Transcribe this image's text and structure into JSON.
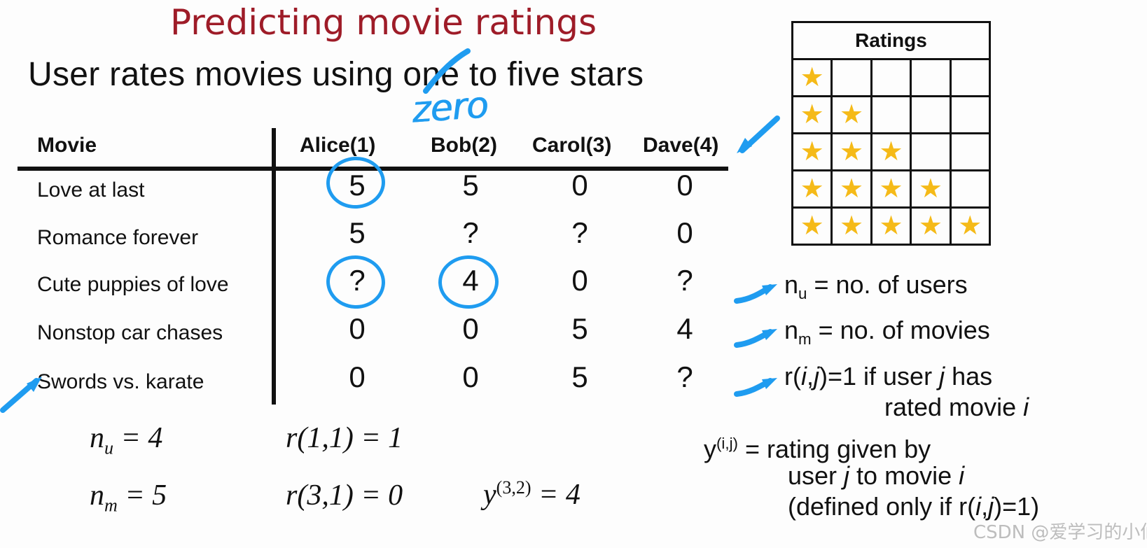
{
  "slide": {
    "title": "Predicting movie ratings",
    "title_color": "#9e1c28",
    "subtitle": "User rates movies using one to five stars",
    "background": "#fdfdfd"
  },
  "ink": {
    "color": "#1f9cf0",
    "zero_annotation": "zero",
    "strikethrough_word": "one",
    "circled_cells": [
      "Love at last / Alice(1) = 5",
      "Cute puppies of love / Alice(1) = ?",
      "Cute puppies of love / Bob(2) = 4"
    ],
    "arrows": [
      "arrow-to-ratings-table",
      "arrow-to-swords-row",
      "arrow-to-nu-note",
      "arrow-to-nm-note",
      "arrow-to-r-note"
    ]
  },
  "matrix": {
    "headers": [
      "Movie",
      "Alice(1)",
      "Bob(2)",
      "Carol(3)",
      "Dave(4)"
    ],
    "rows": [
      {
        "movie": "Love at last",
        "ratings": [
          "5",
          "5",
          "0",
          "0"
        ]
      },
      {
        "movie": "Romance forever",
        "ratings": [
          "5",
          "?",
          "?",
          "0"
        ]
      },
      {
        "movie": "Cute puppies of love",
        "ratings": [
          "?",
          "4",
          "0",
          "?"
        ]
      },
      {
        "movie": "Nonstop car chases",
        "ratings": [
          "0",
          "0",
          "5",
          "4"
        ]
      },
      {
        "movie": "Swords vs. karate",
        "ratings": [
          "0",
          "0",
          "5",
          "?"
        ]
      }
    ]
  },
  "formulas": {
    "n_u": {
      "symbol": "n",
      "sub": "u",
      "rel": " = 4"
    },
    "n_m": {
      "symbol": "n",
      "sub": "m",
      "rel": " = 5"
    },
    "r_1_1": "r(1,1) = 1",
    "r_3_1": "r(3,1) = 0",
    "y_3_2": {
      "base": "y",
      "sup": "(3,2)",
      "rel": " = 4"
    }
  },
  "ratings_table": {
    "header": "Ratings",
    "columns": 5,
    "rows": 5,
    "filled_stars_per_row": [
      1,
      2,
      3,
      4,
      5
    ],
    "star_glyph": "★",
    "star_color": "#F5BA18"
  },
  "notes": {
    "nu": {
      "sym": "n",
      "sub": "u",
      "text": " = no. of users"
    },
    "nm": {
      "sym": "n",
      "sub": "m",
      "text": " = no. of movies"
    },
    "r_line1_a": "r(",
    "r_line1_i": "i",
    "r_line1_b": ",",
    "r_line1_j": "j",
    "r_line1_c": ")=1 if user ",
    "r_line1_j2": "j",
    "r_line1_d": " has",
    "r_line2_a": "rated movie ",
    "r_line2_i": "i",
    "y_base": "y",
    "y_sup": "(i,j)",
    "y_line1": " = rating given by",
    "y_line2_a": "user ",
    "y_line2_j": "j",
    "y_line2_b": " to movie ",
    "y_line2_i": "i",
    "y_line3_a": "(defined only if r(",
    "y_line3_i": "i",
    "y_line3_b": ",",
    "y_line3_j": "j",
    "y_line3_c": ")=1)"
  },
  "watermark": "CSDN @爱学习的小仙女"
}
